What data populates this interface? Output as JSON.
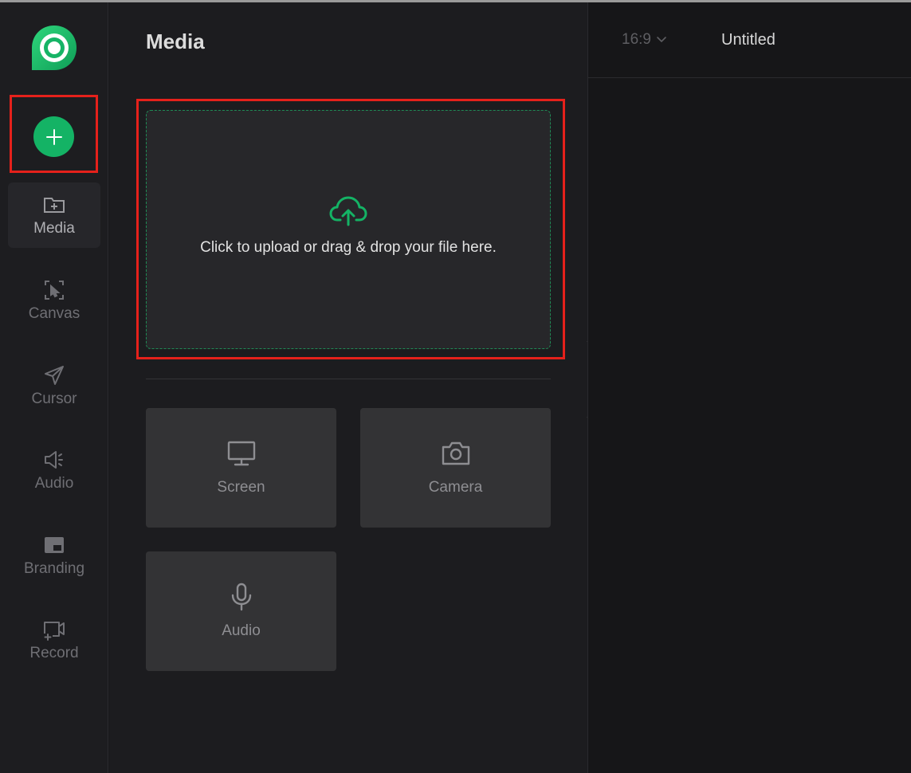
{
  "sidebar": {
    "add_button_icon": "plus-icon",
    "items": [
      {
        "label": "Media",
        "icon": "folder-plus-icon",
        "active": true
      },
      {
        "label": "Canvas",
        "icon": "canvas-select-icon"
      },
      {
        "label": "Cursor",
        "icon": "cursor-arrow-icon"
      },
      {
        "label": "Audio",
        "icon": "speaker-icon"
      },
      {
        "label": "Branding",
        "icon": "branding-icon"
      },
      {
        "label": "Record",
        "icon": "record-video-icon"
      }
    ]
  },
  "panel": {
    "title": "Media",
    "dropzone_text": "Click to upload or drag & drop your file here.",
    "tiles": [
      {
        "label": "Screen",
        "icon": "monitor-icon"
      },
      {
        "label": "Camera",
        "icon": "camera-icon"
      },
      {
        "label": "Audio",
        "icon": "microphone-icon"
      }
    ]
  },
  "topbar": {
    "aspect_ratio": "16:9",
    "document_title": "Untitled"
  },
  "colors": {
    "accent": "#14b365",
    "highlight": "#e5211b",
    "background": "#17171a"
  }
}
